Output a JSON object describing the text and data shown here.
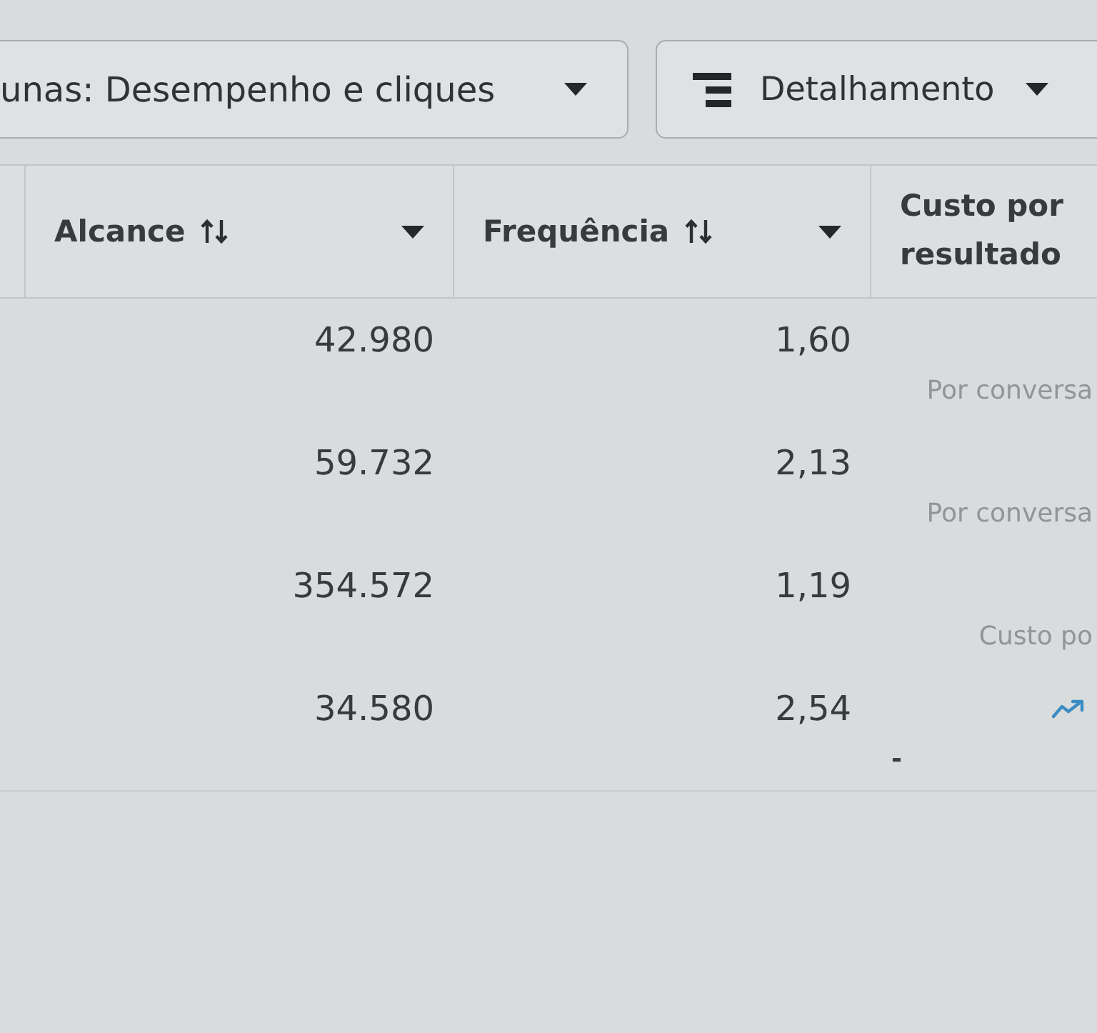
{
  "toolbar": {
    "buttons": [
      {
        "kind": "columns",
        "label": "unas: Desempenho e cliques"
      },
      {
        "kind": "breakdown",
        "label": "Detalhamento"
      }
    ]
  },
  "table": {
    "columns": [
      {
        "label": "Alcance",
        "sortable": true,
        "menu": true
      },
      {
        "label": "Frequência",
        "sortable": true,
        "menu": true
      },
      {
        "label": "Custo por resultado",
        "sortable": false,
        "menu": false
      }
    ],
    "rows": [
      {
        "reach": "42.980",
        "frequency": "1,60",
        "cost": {
          "kind": "note",
          "text": "Por conversa"
        }
      },
      {
        "reach": "59.732",
        "frequency": "2,13",
        "cost": {
          "kind": "note",
          "text": "Por conversa"
        }
      },
      {
        "reach": "354.572",
        "frequency": "1,19",
        "cost": {
          "kind": "note",
          "text": "Custo po"
        }
      },
      {
        "reach": "34.580",
        "frequency": "2,54",
        "cost": {
          "kind": "trend",
          "text": "-"
        }
      }
    ]
  }
}
